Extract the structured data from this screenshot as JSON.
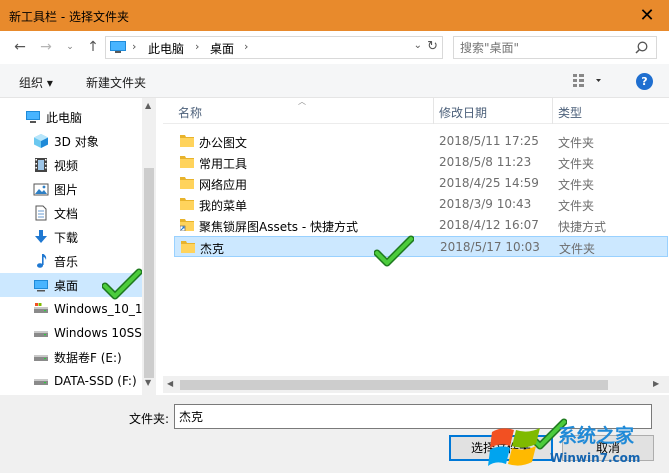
{
  "window": {
    "title": "新工具栏 - 选择文件夹",
    "close_glyph": "✕"
  },
  "address_bar": {
    "crumbs": [
      "此电脑",
      "桌面"
    ],
    "separator": "›"
  },
  "search": {
    "placeholder": "搜索\"桌面\""
  },
  "toolbar": {
    "organize_label": "组织 ▾",
    "new_folder_label": "新建文件夹"
  },
  "navigation": {
    "items": [
      {
        "label": "此电脑",
        "icon": "computer-icon"
      },
      {
        "label": "3D 对象",
        "icon": "cube-icon"
      },
      {
        "label": "视频",
        "icon": "film-icon"
      },
      {
        "label": "图片",
        "icon": "picture-icon"
      },
      {
        "label": "文档",
        "icon": "document-icon"
      },
      {
        "label": "下载",
        "icon": "download-arrow-icon"
      },
      {
        "label": "音乐",
        "icon": "music-note-icon"
      },
      {
        "label": "桌面",
        "icon": "desktop-icon",
        "selected": true
      },
      {
        "label": "Windows_10_1",
        "icon": "drive-icon"
      },
      {
        "label": "Windows 10SS",
        "icon": "drive-icon"
      },
      {
        "label": "数据卷F (E:)",
        "icon": "drive-icon"
      },
      {
        "label": "DATA-SSD (F:)",
        "icon": "drive-icon"
      }
    ]
  },
  "file_list": {
    "columns": {
      "name": "名称",
      "date": "修改日期",
      "type": "类型"
    },
    "rows": [
      {
        "name": "办公图文",
        "date": "2018/5/11 17:25",
        "type": "文件夹",
        "icon": "folder-icon"
      },
      {
        "name": "常用工具",
        "date": "2018/5/8 11:23",
        "type": "文件夹",
        "icon": "folder-icon"
      },
      {
        "name": "网络应用",
        "date": "2018/4/25 14:59",
        "type": "文件夹",
        "icon": "folder-icon"
      },
      {
        "name": "我的菜单",
        "date": "2018/3/9 10:43",
        "type": "文件夹",
        "icon": "folder-icon"
      },
      {
        "name": "聚焦锁屏图Assets - 快捷方式",
        "date": "2018/4/12 16:07",
        "type": "快捷方式",
        "icon": "folder-shortcut-icon"
      },
      {
        "name": "杰克",
        "date": "2018/5/17 10:03",
        "type": "文件夹",
        "icon": "folder-icon",
        "selected": true
      }
    ]
  },
  "footer": {
    "folder_label": "文件夹:",
    "folder_value": "杰克",
    "ok_label": "选择文件夹",
    "cancel_label": "取消"
  },
  "watermark": {
    "brand": "系统之家",
    "url": "Winwin7.com"
  },
  "colors": {
    "titlebar": "#e88a2c",
    "selection": "#cce8ff",
    "accent": "#0078d7",
    "check": "#2fa82f"
  }
}
